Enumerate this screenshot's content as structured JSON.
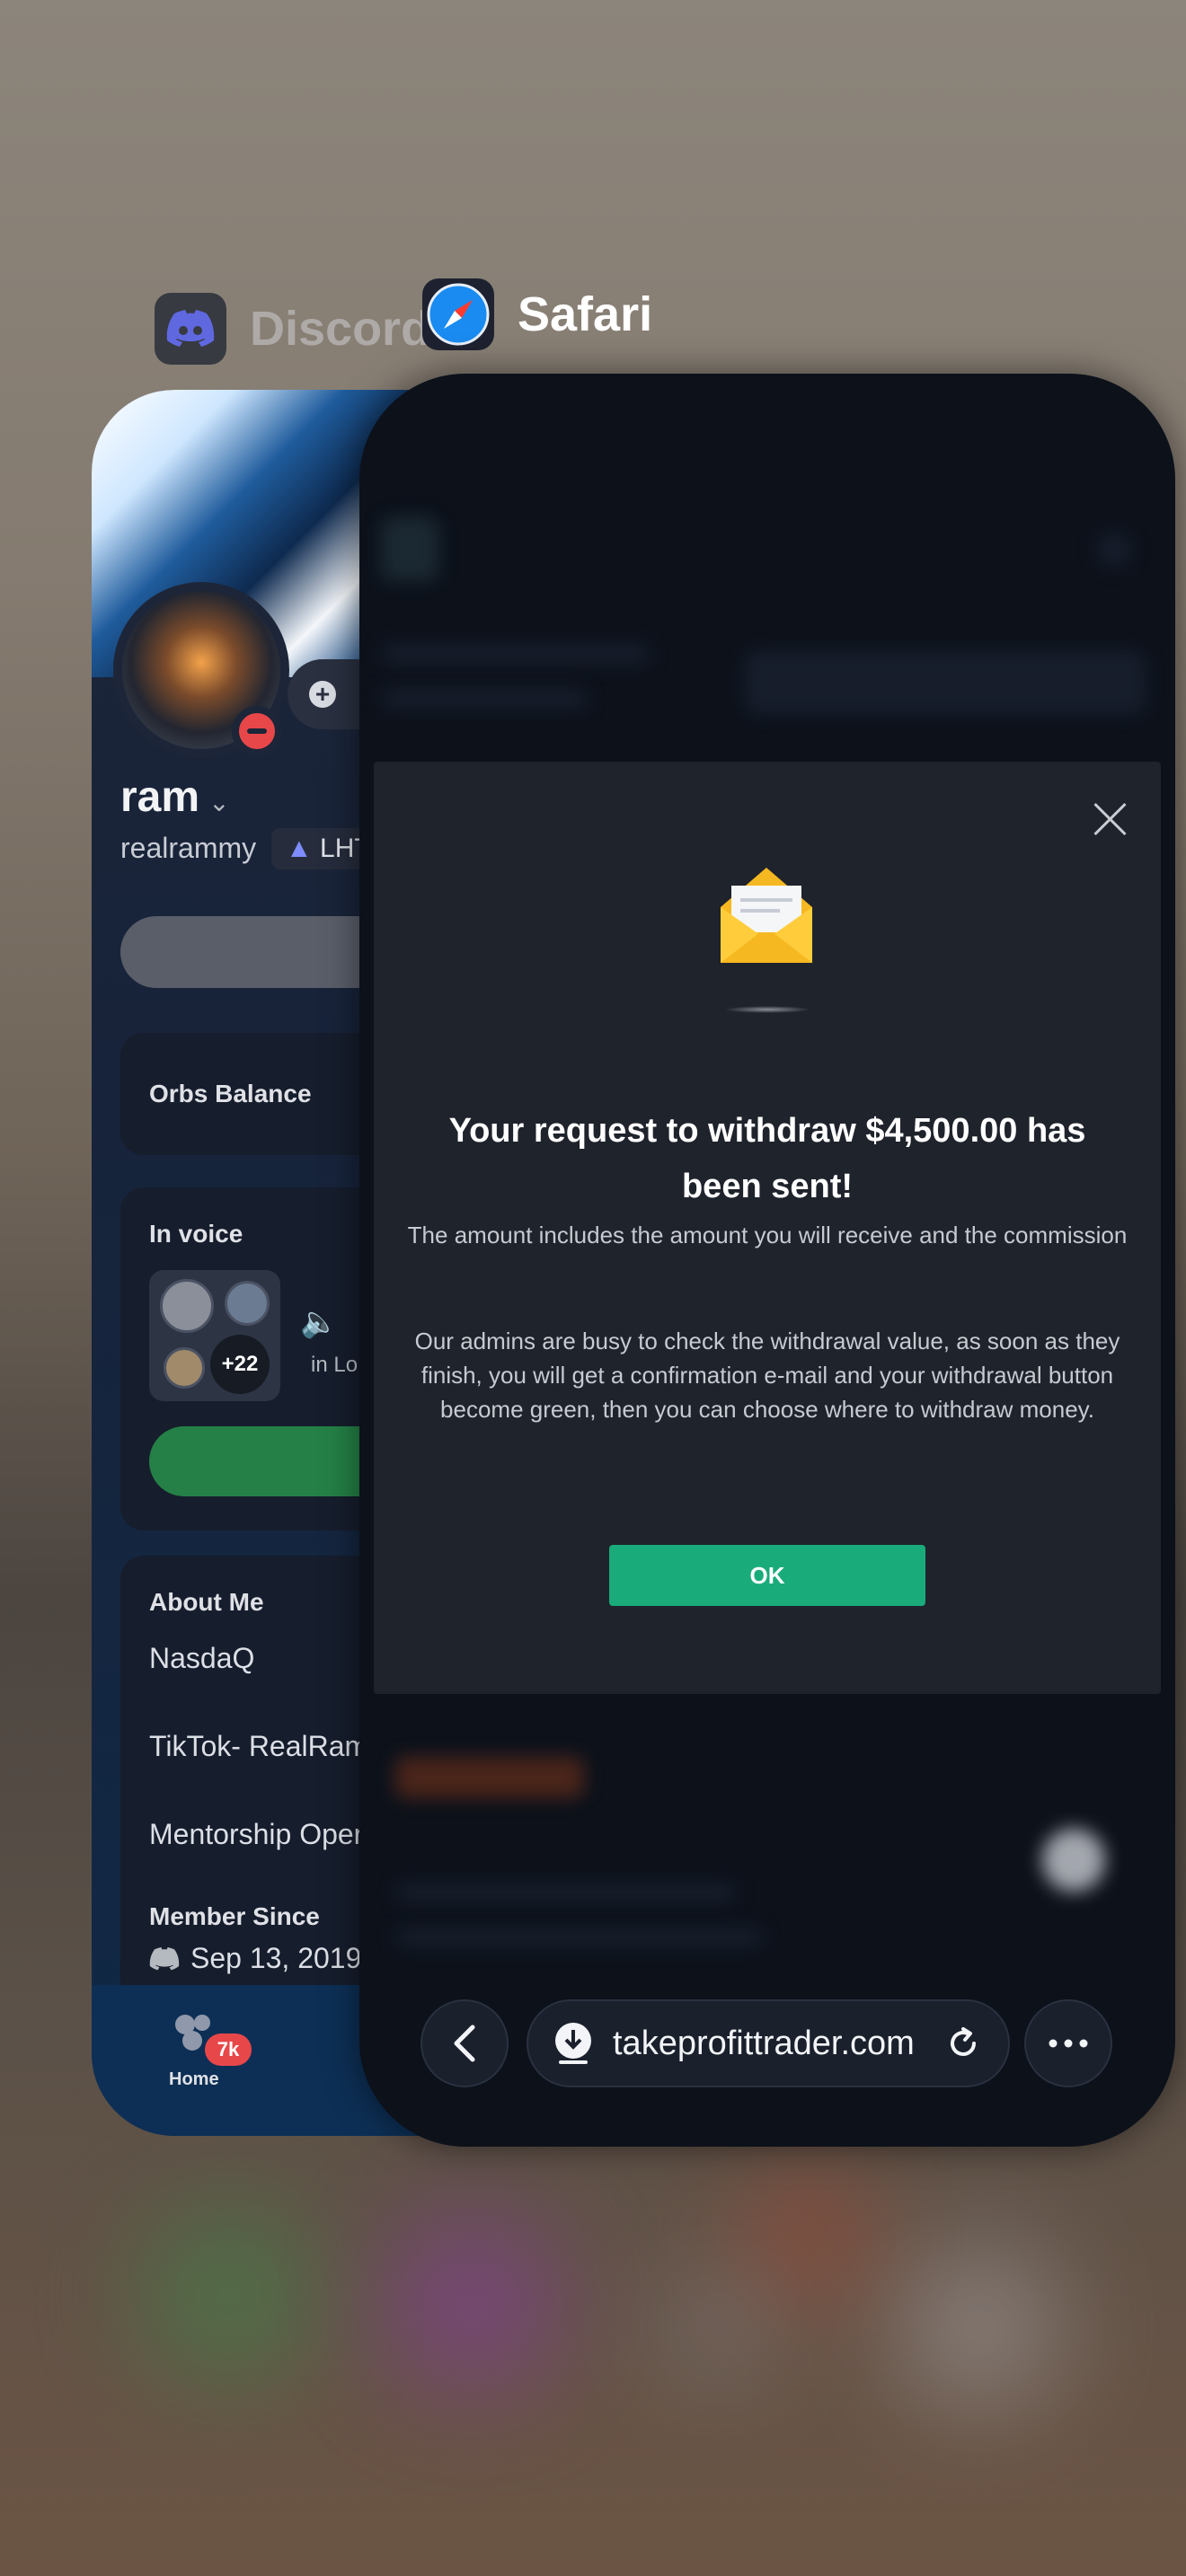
{
  "switcher": {
    "discord_label": "Discord",
    "safari_label": "Safari"
  },
  "discord": {
    "display_name": "ram",
    "username": "realrammy",
    "server_tag": "LHT",
    "add_status_label": "+",
    "orbs_label": "Orbs Balance",
    "in_voice_label": "In voice",
    "voice_extra_count": "+22",
    "voice_location": "in Lo",
    "about_me_label": "About Me",
    "about_lines": [
      "NasdaQ",
      "TikTok- RealRam",
      "Mentorship Oper"
    ],
    "member_since_label": "Member Since",
    "member_since_date": "Sep 13, 2019",
    "nav_home_label": "Home",
    "nav_home_badge": "7k",
    "accent_color": "#5865f2"
  },
  "modal": {
    "title": "Your request to withdraw $4,500.00 has been sent!",
    "paragraph1": "The amount includes the amount you will receive and the commission",
    "paragraph2": "Our admins are busy to check the withdrawal value, as soon as they finish, you will get a confirmation e-mail and your withdrawal button become green, then you can choose where to withdraw money.",
    "ok_label": "OK",
    "ok_color": "#1aab7a"
  },
  "safari": {
    "url": "takeprofittrader.com"
  }
}
